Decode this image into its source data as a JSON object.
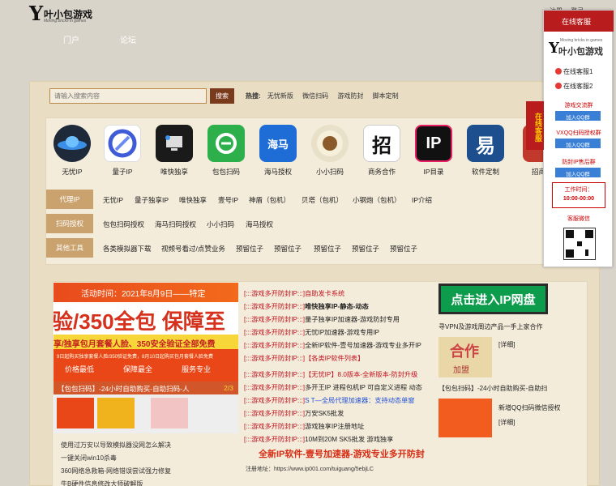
{
  "header": {
    "logo_letter": "Y",
    "logo_text": "叶小包游戏",
    "logo_sub": "Moving bricks in games",
    "links": [
      "注册",
      "登录"
    ]
  },
  "nav": [
    "门户",
    "论坛"
  ],
  "search": {
    "placeholder": "请输入搜索内容",
    "button": "搜索"
  },
  "hot": {
    "label": "热搜:",
    "items": [
      "无忧新版",
      "微信扫码",
      "游戏防封",
      "脚本定制"
    ]
  },
  "icons": [
    {
      "label": "无忧IP",
      "color": "#1e2a3a"
    },
    {
      "label": "量子IP",
      "color": "#3f5bd7"
    },
    {
      "label": "唯快独享",
      "color": "#1a1a1a"
    },
    {
      "label": "包包扫码",
      "color": "#2db04b"
    },
    {
      "label": "海马授权",
      "color": "#1e6cd6",
      "glyph": "海马"
    },
    {
      "label": "小小扫码",
      "color": "#e8e0c8"
    },
    {
      "label": "商务合作",
      "color": "#ffffff",
      "glyph": "招"
    },
    {
      "label": "IP目录",
      "color": "#111111",
      "glyph": "IP"
    },
    {
      "label": "软件定制",
      "color": "#1d4f8f",
      "glyph": "易"
    },
    {
      "label": "招商",
      "color": "#c0392b"
    }
  ],
  "rows": [
    {
      "label": "代理IP",
      "items": [
        "无忧IP",
        "量子独享IP",
        "唯快独享",
        "壹号IP",
        "神盾（包机）",
        "贝塔（包机）",
        "小钢炮（包机）",
        "IP介绍"
      ]
    },
    {
      "label": "扫码授权",
      "items": [
        "包包扫码授权",
        "海马扫码授权",
        "小小扫码",
        "海马授权"
      ]
    },
    {
      "label": "其他工具",
      "items": [
        "各类模拟器下载",
        "视频号看过/点赞业务",
        "预留位子",
        "预留位子",
        "预留位子",
        "预留位子",
        "预留位子"
      ]
    }
  ],
  "banner": {
    "top": "活动时间：2021年8月9日——特定",
    "big": "验/350全包 保障至",
    "mid": "享/独享包月套餐人脸、350安全验证全部免费",
    "note": "9日起购买独享套餐人脸/350验证免费，8月10日起购买包月套餐人脸免费",
    "features": [
      "价格最低",
      "保障最全",
      "服务专业"
    ],
    "caption": "【包包扫码】-24小时自助购买-自助扫码-人",
    "pager": "2/3"
  },
  "news": [
    {
      "tag": "[:::游戏多开防封IP:::]",
      "text": "自助发卡系统",
      "red": true
    },
    {
      "tag": "[:::游戏多开防封IP:::]",
      "text": "唯快独享IP-静态-动态",
      "bold": true
    },
    {
      "tag": "[:::游戏多开防封IP:::]",
      "text": "量子独享IP加速器-游戏防封专用"
    },
    {
      "tag": "[:::游戏多开防封IP:::]",
      "text": "无忧IP加速器-游戏专用IP"
    },
    {
      "tag": "[:::游戏多开防封IP:::]",
      "text": "全新IP软件-壹号加速器-游戏专业多开IP"
    },
    {
      "tag": "[:::游戏多开防封IP:::]",
      "text": "【各类IP软件列表】",
      "red": true
    },
    {
      "tag": "[:::游戏多开防封IP:::]",
      "text": "【无忧IP】8.0版本-全新版本-防封升级",
      "red": true
    },
    {
      "tag": "[:::游戏多开防封IP:::]",
      "text": "多开王IP 进程包机IP 可自定义进程 动态"
    },
    {
      "tag": "[:::游戏多开防封IP:::]",
      "text": "S T—全局代理加速器：支持动态单窗",
      "blue": true
    },
    {
      "tag": "[:::游戏多开防封IP:::]",
      "text": "万安SK5批发"
    },
    {
      "tag": "[:::游戏多开防封IP:::]",
      "text": "游戏独享IP注册地址"
    },
    {
      "tag": "[:::游戏多开防封IP:::]",
      "text": "10M到20M SK5批发 游戏独享"
    }
  ],
  "news_big": "全新IP软件-壹号加速器-游戏专业多开防封",
  "register": "注册地址：https://www.ip001.com/tuiguang/5ebjLC",
  "left_list": [
    "使用过万安以导致模拟器没网怎么解决",
    "一键关闭win10杀毒",
    "360网络急救箱-网络错误尝试强力修复",
    "牛B硬件信息修改大师破解版"
  ],
  "right": {
    "ip_button": "点击进入IP网盘",
    "line1": "寻VPN及游戏周边产品一手上家合作",
    "coop_label": "[详细]",
    "img1_big": "合作",
    "img1_small": "加盟",
    "caption2": "【包包扫码】-24小时自助购买-自助扫",
    "line2a": "新增QQ扫码微信授权",
    "line2b": "[详细]"
  },
  "float_panel": {
    "head": "在线客服",
    "tab": "在线客服",
    "logo_letter": "Y",
    "logo_text": "叶小包游戏",
    "logo_sub": "Moving bricks in games",
    "cs": [
      "在线客服1",
      "在线客服2"
    ],
    "groups": [
      {
        "title": "游戏交流群",
        "qq": "加入QQ群"
      },
      {
        "title": "VXQQ扫码授权群",
        "qq": "加入QQ群"
      },
      {
        "title": "防封IP售后群",
        "qq": "加入QQ群"
      }
    ],
    "hours_title": "工作时间：",
    "hours": "10:00-00:00",
    "wechat": "客服微信"
  }
}
